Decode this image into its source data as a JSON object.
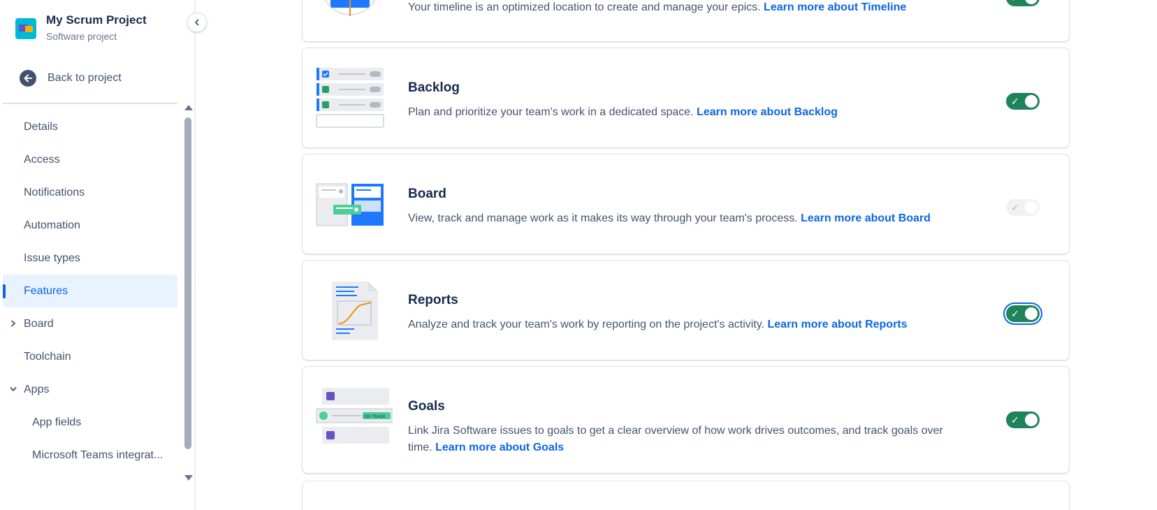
{
  "sidebar": {
    "project_name": "My Scrum Project",
    "project_type": "Software project",
    "back_label": "Back to project",
    "items": [
      {
        "label": "Details"
      },
      {
        "label": "Access"
      },
      {
        "label": "Notifications"
      },
      {
        "label": "Automation"
      },
      {
        "label": "Issue types"
      },
      {
        "label": "Features",
        "selected": true
      },
      {
        "label": "Board",
        "expandable": true
      },
      {
        "label": "Toolchain"
      },
      {
        "label": "Apps",
        "expanded": true
      },
      {
        "label": "App fields",
        "sub": true
      },
      {
        "label": "Microsoft Teams integrat...",
        "sub": true
      }
    ]
  },
  "features": [
    {
      "name": "",
      "description": "Your timeline is an optimized location to create and manage your epics.",
      "link": "Learn more about Timeline",
      "enabled": true
    },
    {
      "name": "Backlog",
      "description": "Plan and prioritize your team's work in a dedicated space.",
      "link": "Learn more about Backlog",
      "enabled": true
    },
    {
      "name": "Board",
      "description": "View, track and manage work as it makes its way through your team's process.",
      "link": "Learn more about Board",
      "enabled": true,
      "disabled": true
    },
    {
      "name": "Reports",
      "description": "Analyze and track your team's work by reporting on the project's activity.",
      "link": "Learn more about Reports",
      "enabled": true,
      "focused": true
    },
    {
      "name": "Goals",
      "description": "Link Jira Software issues to goals to get a clear overview of how work drives outcomes, and track goals over time.",
      "link": "Learn more about Goals",
      "enabled": true,
      "badge": "ON TRACK"
    }
  ],
  "colors": {
    "accent": "#0c66e4",
    "toggle_on": "#1f845a",
    "selected_bg": "#e9f2ff"
  }
}
